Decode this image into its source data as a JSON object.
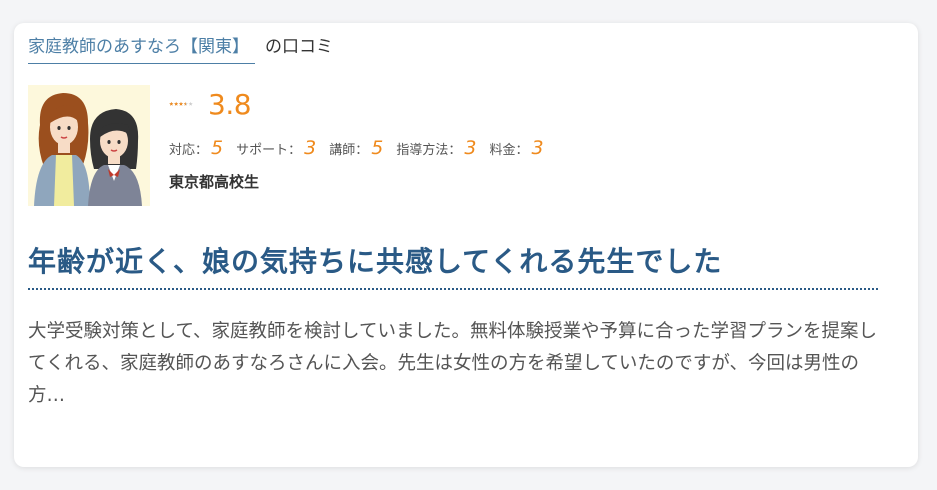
{
  "header": {
    "provider_link": "家庭教師のあすなろ【関東】",
    "suffix": "の口コミ"
  },
  "rating": {
    "value": 3.8,
    "score_text": "3.8",
    "star_fill": [
      1,
      1,
      1,
      0.5,
      0
    ],
    "star_color": "#ef8a1d",
    "star_empty_color": "#cccccc"
  },
  "subratings": [
    {
      "label": "対応：",
      "value": "5"
    },
    {
      "label": "サポート：",
      "value": "3"
    },
    {
      "label": "講師：",
      "value": "5"
    },
    {
      "label": "指導方法：",
      "value": "3"
    },
    {
      "label": "料金：",
      "value": "3"
    }
  ],
  "reviewer": "東京都高校生",
  "review": {
    "headline": "年齢が近く、娘の気持ちに共感してくれる先生でした",
    "body": "大学受験対策として、家庭教師を検討していました。無料体験授業や予算に合った学習プランを提案してくれる、家庭教師のあすなろさんに入会。先生は女性の方を希望していたのですが、今回は男性の方…"
  },
  "colors": {
    "accent_orange": "#ef8a1d",
    "headline_blue": "#2a5a86",
    "link_blue": "#4d7fa6"
  },
  "icons": {
    "avatar": "mother-and-daughter-illustration",
    "star": "star-icon"
  }
}
